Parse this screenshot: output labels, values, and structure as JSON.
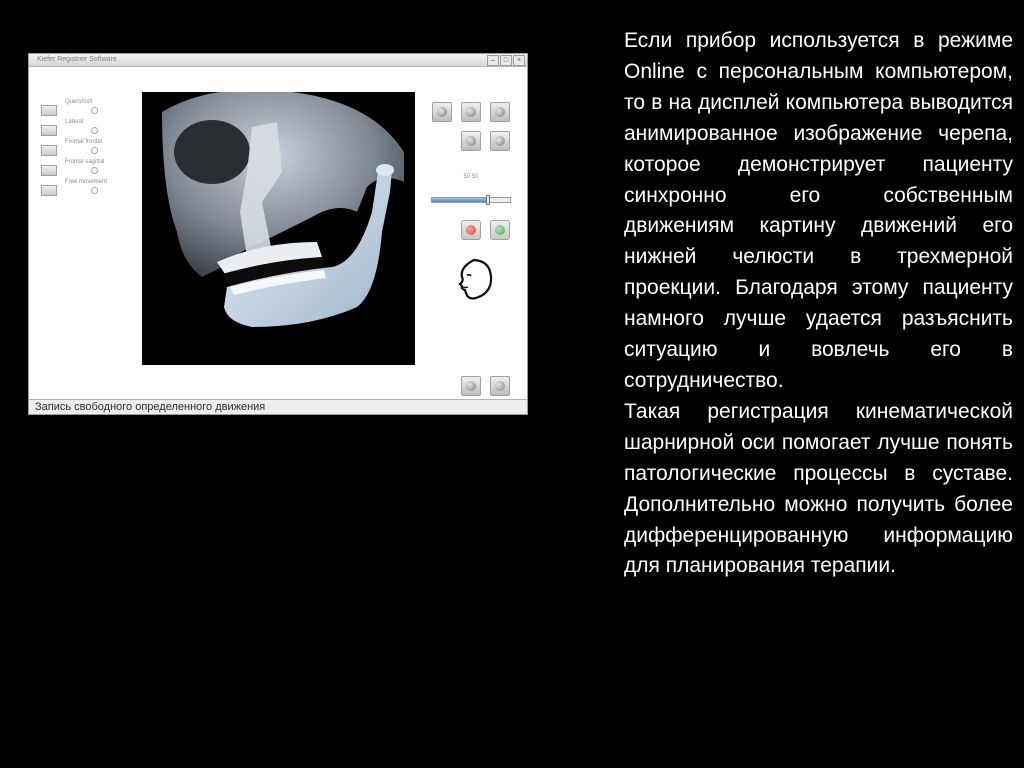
{
  "app_window": {
    "title": "Kiefer Registrier Software",
    "view_options": [
      {
        "label": "Quershnitt"
      },
      {
        "label": "Lateral"
      },
      {
        "label": "Frontal frontal"
      },
      {
        "label": "Frontal sagittal"
      },
      {
        "label": "Free movement"
      }
    ],
    "slider": {
      "label": "50 50",
      "value_percent": 72
    },
    "status_text": "Запись свободного определенного движения",
    "colors": {
      "record_button": "#d84a3a",
      "play_button": "#4caf50",
      "skull_tone": "#b9c6d4",
      "mandible_tone": "#d3e2f2"
    },
    "icons": {
      "zoom_in": "magnifier-plus-icon",
      "zoom_out": "magnifier-minus-icon",
      "reset_view": "magnifier-icon",
      "layers": "layers-icon",
      "pen": "pen-icon",
      "record": "record-icon",
      "play": "play-icon",
      "save": "save-icon",
      "settings": "settings-icon",
      "face": "face-profile-icon"
    }
  },
  "description": {
    "paragraph1": "Если прибор используется в режиме Online с персональным компьютером, то в на дисплей компьютера выводится анимированное изображение черепа, которое демонстрирует пациенту синхронно его собственным движениям картину движений его нижней челюсти в трехмерной проекции. Благодаря этому пациенту намного лучше удается разъяснить ситуацию и вовлечь его в сотрудничество.",
    "paragraph2": "Такая регистрация кинематической шарнирной оси помогает лучше понять патологические процессы в суставе. Дополнительно можно получить более дифференцированную информацию для планирования терапии."
  }
}
